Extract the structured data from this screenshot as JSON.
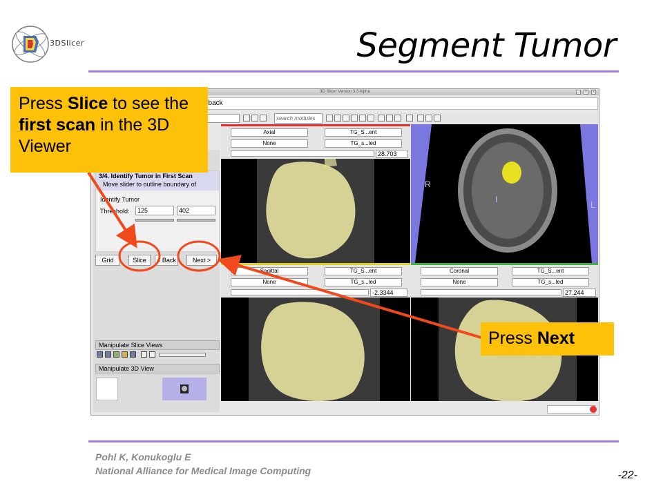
{
  "slide": {
    "title": "Segment Tumor",
    "logo_text": "3DSlicer",
    "footer_author": "Pohl K, Konukoglu E",
    "footer_org": "National Alliance for Medical Image Computing",
    "page_number": "-22-"
  },
  "app": {
    "window_title": "3D Slicer Version 3.3 Alpha",
    "menubar_text": "dback",
    "search_placeholder": "search modules",
    "step_title": "3/4. Identify Tumor in First Scan",
    "step_desc": "Move slider to outline boundary of",
    "fieldset_label": "Identify Tumor",
    "threshold_label": "Threshold:",
    "threshold_low": "125",
    "threshold_high": "402",
    "buttons": {
      "grid": "Grid",
      "slice": "Slice",
      "back": "< Back",
      "next": "Next >"
    },
    "modules": {
      "slice_views": "Manipulate Slice Views",
      "view_3d": "Manipulate 3D View"
    },
    "viewers": {
      "axial": {
        "orient": "Axial",
        "fg": "TG_S...ent",
        "label": "None",
        "label_fg": "TG_s...led",
        "offset": "28.703"
      },
      "sagittal": {
        "orient": "Sagittal",
        "fg": "TG_S...ent",
        "label": "None",
        "label_fg": "TG_s...led",
        "offset": "-2.3344"
      },
      "coronal": {
        "orient": "Coronal",
        "fg": "TG_S...ent",
        "label": "None",
        "label_fg": "TG_s...led",
        "offset": "27.244"
      }
    },
    "view3d_labels": {
      "right": "R",
      "left": "L",
      "inferior": "I"
    }
  },
  "callouts": {
    "slice": {
      "pre": "Press ",
      "bold1": "Slice",
      "mid1": " to see the ",
      "bold2": "first scan",
      "mid2": " in the 3D Viewer"
    },
    "next": {
      "pre": "Press ",
      "bold": "Next"
    }
  },
  "colors": {
    "rule": "#9c7ee0",
    "callout": "#fec10a",
    "arrow": "#f04a1c",
    "tumor": "#ece6a0"
  }
}
